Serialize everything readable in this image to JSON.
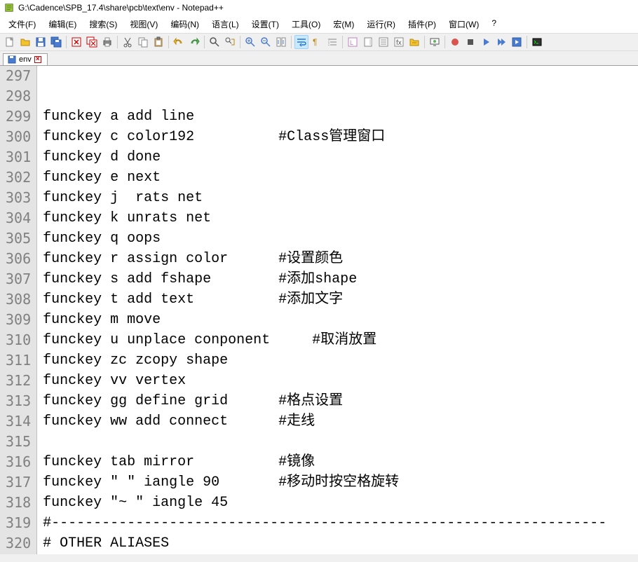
{
  "title": "G:\\Cadence\\SPB_17.4\\share\\pcb\\text\\env - Notepad++",
  "menu": [
    "文件(F)",
    "编辑(E)",
    "搜索(S)",
    "视图(V)",
    "编码(N)",
    "语言(L)",
    "设置(T)",
    "工具(O)",
    "宏(M)",
    "运行(R)",
    "插件(P)",
    "窗口(W)",
    "?"
  ],
  "tab": {
    "label": "env"
  },
  "lines": [
    {
      "n": "297",
      "t": ""
    },
    {
      "n": "298",
      "t": ""
    },
    {
      "n": "299",
      "t": "funckey a add line"
    },
    {
      "n": "300",
      "t": "funckey c color192          #Class管理窗口"
    },
    {
      "n": "301",
      "t": "funckey d done"
    },
    {
      "n": "302",
      "t": "funckey e next"
    },
    {
      "n": "303",
      "t": "funckey j  rats net"
    },
    {
      "n": "304",
      "t": "funckey k unrats net"
    },
    {
      "n": "305",
      "t": "funckey q oops"
    },
    {
      "n": "306",
      "t": "funckey r assign color      #设置颜色"
    },
    {
      "n": "307",
      "t": "funckey s add fshape        #添加shape"
    },
    {
      "n": "308",
      "t": "funckey t add text          #添加文字"
    },
    {
      "n": "309",
      "t": "funckey m move"
    },
    {
      "n": "310",
      "t": "funckey u unplace conponent     #取消放置"
    },
    {
      "n": "311",
      "t": "funckey zc zcopy shape"
    },
    {
      "n": "312",
      "t": "funckey vv vertex"
    },
    {
      "n": "313",
      "t": "funckey gg define grid      #格点设置"
    },
    {
      "n": "314",
      "t": "funckey ww add connect      #走线"
    },
    {
      "n": "315",
      "t": ""
    },
    {
      "n": "316",
      "t": "funckey tab mirror          #镜像"
    },
    {
      "n": "317",
      "t": "funckey \" \" iangle 90       #移动时按空格旋转"
    },
    {
      "n": "318",
      "t": "funckey \"~ \" iangle 45"
    },
    {
      "n": "319",
      "t": "#------------------------------------------------------------------"
    },
    {
      "n": "320",
      "t": "# OTHER ALIASES"
    }
  ]
}
